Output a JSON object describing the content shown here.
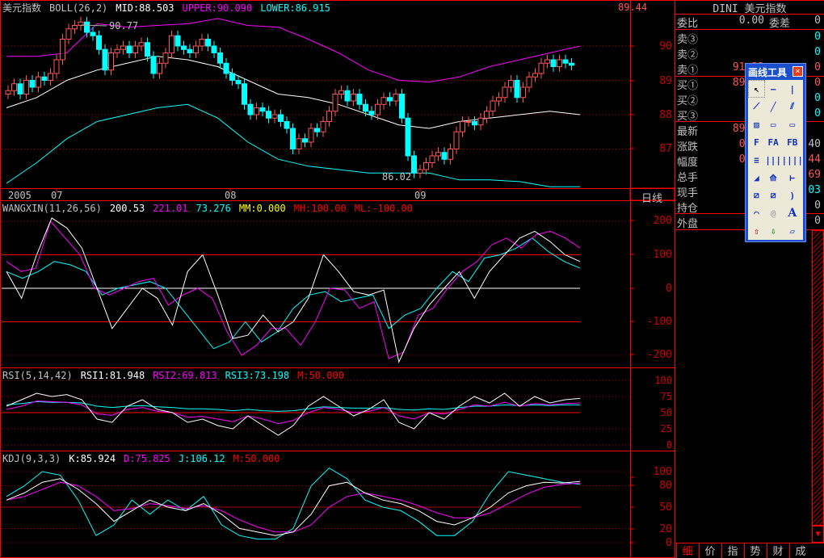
{
  "price_panel": {
    "title": "美元指数",
    "indicator": "BOLL(26,2)",
    "mid": "MID:88.503",
    "upper": "UPPER:90.090",
    "lower": "LOWER:86.915",
    "last": "89.44",
    "high_label": "90.77",
    "low_label": "86.02",
    "axis": [
      "90",
      "89",
      "88",
      "87"
    ],
    "time_labels": [
      "2005",
      "07",
      "08",
      "09"
    ],
    "period": "日线",
    "closes": [
      88.7,
      88.9,
      88.6,
      89.0,
      88.8,
      89.1,
      89.0,
      89.2,
      89.6,
      90.2,
      90.5,
      90.6,
      90.7,
      90.4,
      90.3,
      89.9,
      89.3,
      89.8,
      89.9,
      90.0,
      89.8,
      90.0,
      90.1,
      89.7,
      89.2,
      89.5,
      89.8,
      90.3,
      90.0,
      89.9,
      89.8,
      90.0,
      90.2,
      90.0,
      89.8,
      89.5,
      89.2,
      89.0,
      88.9,
      88.3,
      88.0,
      88.2,
      88.1,
      87.9,
      88.0,
      87.8,
      87.6,
      87.0,
      87.3,
      87.2,
      87.6,
      87.5,
      87.8,
      88.1,
      88.6,
      88.7,
      88.4,
      88.6,
      88.3,
      88.1,
      88.0,
      88.3,
      88.5,
      88.4,
      88.6,
      87.9,
      86.8,
      86.3,
      86.4,
      86.6,
      86.8,
      86.9,
      86.7,
      87.0,
      87.5,
      87.8,
      87.8,
      87.7,
      87.9,
      88.1,
      88.4,
      88.5,
      88.8,
      89.0,
      88.5,
      88.8,
      89.1,
      89.2,
      89.5,
      89.6,
      89.4,
      89.6,
      89.5,
      89.44
    ],
    "upper_line": [
      89.7,
      89.7,
      89.8,
      90.65,
      90.55,
      90.6,
      90.65,
      90.8,
      90.6,
      90.55,
      90.2,
      89.8,
      89.3,
      89.0,
      88.95,
      89.1,
      89.4,
      89.6,
      89.8,
      90.0
    ],
    "mid_line": [
      88.2,
      88.5,
      89.0,
      89.3,
      89.5,
      89.7,
      89.6,
      89.4,
      89.0,
      88.6,
      88.5,
      88.3,
      88.0,
      87.7,
      87.6,
      87.8,
      87.9,
      88.0,
      88.1,
      88.0
    ],
    "lower_line": [
      86.0,
      86.6,
      87.3,
      87.8,
      88.0,
      88.2,
      88.3,
      87.9,
      87.2,
      86.7,
      86.5,
      86.4,
      86.3,
      86.3,
      86.3,
      86.1,
      86.1,
      86.05,
      85.9,
      85.9
    ]
  },
  "wangxin": {
    "title": "WANGXIN(11,26,56)",
    "v1": "200.53",
    "v2": "221.01",
    "v3": "73.276",
    "mm": "MM:0.000",
    "mh": "MH:100.00",
    "ml": "ML:-100.00",
    "axis": [
      "200",
      "100",
      "0",
      "-100",
      "-200"
    ],
    "white": [
      50,
      -30,
      100,
      210,
      180,
      120,
      0,
      -120,
      -60,
      0,
      -30,
      -110,
      50,
      100,
      -20,
      -150,
      -140,
      -80,
      -130,
      -100,
      -30,
      100,
      50,
      -10,
      -20,
      -5,
      -220,
      -120,
      -50,
      0,
      50,
      -30,
      50,
      100,
      150,
      170,
      140,
      100,
      80
    ],
    "magenta": [
      80,
      50,
      60,
      200,
      150,
      100,
      0,
      -20,
      0,
      20,
      30,
      -50,
      -20,
      0,
      -30,
      -130,
      -200,
      -170,
      -120,
      -120,
      -170,
      -100,
      0,
      -5,
      -60,
      -40,
      -210,
      -190,
      -80,
      -60,
      0,
      50,
      80,
      130,
      150,
      120,
      160,
      170,
      150,
      120
    ],
    "cyan": [
      50,
      30,
      50,
      80,
      70,
      50,
      -20,
      0,
      10,
      20,
      0,
      -60,
      -120,
      -180,
      -160,
      -100,
      -160,
      -130,
      -60,
      -20,
      -10,
      -40,
      -30,
      -20,
      -120,
      -80,
      -60,
      0,
      50,
      20,
      90,
      100,
      120,
      150,
      110,
      80,
      60
    ]
  },
  "rsi": {
    "title": "RSI(5,14,42)",
    "r1": "RSI1:81.948",
    "r2": "RSI2:69.813",
    "r3": "RSI3:73.198",
    "m": "M:50.000",
    "axis": [
      "100",
      "75",
      "50",
      "25",
      "0"
    ],
    "white": [
      60,
      70,
      80,
      75,
      78,
      70,
      40,
      35,
      60,
      70,
      55,
      50,
      35,
      40,
      30,
      25,
      45,
      30,
      15,
      30,
      60,
      75,
      60,
      45,
      55,
      70,
      35,
      25,
      50,
      40,
      60,
      75,
      65,
      80,
      60,
      75,
      65,
      70,
      72
    ],
    "magenta": [
      55,
      60,
      68,
      67,
      66,
      62,
      48,
      46,
      55,
      58,
      52,
      50,
      43,
      44,
      40,
      36,
      45,
      40,
      33,
      38,
      50,
      58,
      55,
      50,
      52,
      58,
      45,
      40,
      50,
      48,
      55,
      62,
      60,
      66,
      60,
      64,
      62,
      64,
      65
    ],
    "cyan": [
      62,
      64,
      67,
      66,
      66,
      65,
      60,
      58,
      60,
      61,
      59,
      58,
      56,
      56,
      55,
      53,
      55,
      53,
      52,
      53,
      56,
      59,
      58,
      57,
      57,
      58,
      55,
      54,
      56,
      55,
      58,
      60,
      60,
      62,
      61,
      62,
      61,
      62,
      62
    ]
  },
  "kdj": {
    "title": "KDJ(9,3,3)",
    "k": "K:85.924",
    "d": "D:75.825",
    "j": "J:106.12",
    "m": "M:50.000",
    "axis": [
      "100",
      "80",
      "50",
      "20",
      "0"
    ],
    "white": [
      60,
      70,
      85,
      90,
      75,
      55,
      30,
      45,
      60,
      50,
      45,
      55,
      40,
      20,
      15,
      10,
      15,
      40,
      80,
      85,
      70,
      60,
      55,
      45,
      30,
      25,
      35,
      50,
      70,
      80,
      85,
      84,
      86
    ],
    "magenta": [
      60,
      65,
      75,
      85,
      80,
      65,
      45,
      48,
      55,
      52,
      48,
      52,
      45,
      32,
      22,
      15,
      15,
      25,
      50,
      65,
      70,
      65,
      60,
      52,
      42,
      35,
      35,
      42,
      55,
      68,
      78,
      82,
      84
    ],
    "cyan": [
      65,
      80,
      100,
      95,
      60,
      10,
      25,
      60,
      40,
      60,
      45,
      65,
      25,
      10,
      5,
      5,
      20,
      80,
      105,
      90,
      60,
      50,
      45,
      30,
      10,
      10,
      30,
      70,
      100,
      95,
      90,
      85,
      82
    ]
  },
  "quote": {
    "title": "DINI 美元指数",
    "rows": [
      {
        "k": "委比",
        "v": "0.00",
        "mid": "委差",
        "e": "0"
      },
      {
        "k": "卖③",
        "v": "",
        "e": "0"
      },
      {
        "k": "卖②",
        "v": "",
        "e": "0"
      },
      {
        "k": "卖①",
        "v": "91.23",
        "e": "0"
      },
      {
        "k": "买①",
        "v": "89.44",
        "e": "0"
      },
      {
        "k": "买②",
        "v": "",
        "e": "0"
      },
      {
        "k": "买③",
        "v": "",
        "e": "0"
      },
      {
        "k": "最新",
        "v": "89.44",
        "e": ""
      },
      {
        "k": "涨跌",
        "v": "0.04",
        "e": "40"
      },
      {
        "k": "幅度",
        "v": "0.04",
        "e": "44"
      },
      {
        "k": "总手",
        "v": "0",
        "e": "69"
      },
      {
        "k": "现手",
        "v": "0",
        "e": "03"
      },
      {
        "k": "持仓",
        "v": "0",
        "e": "0"
      },
      {
        "k": "外盘",
        "v": "0",
        "e": "0"
      }
    ],
    "tabs": [
      "细",
      "价",
      "指",
      "势",
      "财",
      "成"
    ]
  },
  "toolbar": {
    "title": "画线工具",
    "close": "×",
    "tools": [
      "arrow",
      "hline",
      "vline",
      "segment",
      "line",
      "parallel",
      "channel",
      "rect",
      "box",
      "fib",
      "fa",
      "fb",
      "percent",
      "period",
      "period2",
      "gann",
      "fan",
      "angle",
      "regress",
      "regress2",
      "arc",
      "arc2",
      "spiral",
      "text",
      "up-arrow",
      "down-arrow",
      "eraser"
    ],
    "text_glyph": "A"
  },
  "colors": {
    "border": "#ff0000",
    "up": "#ff5555",
    "down": "#00ffff",
    "boll_upper": "#ff00ff",
    "boll_mid": "#ffffff",
    "boll_lower": "#00ffff"
  }
}
